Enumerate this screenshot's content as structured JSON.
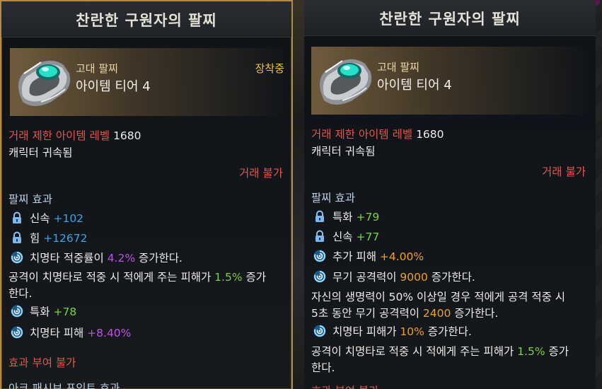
{
  "left": {
    "title": "찬란한 구원자의 팔찌",
    "grade": "고대 팔찌",
    "tier": "아이템 티어 4",
    "equipped": "장착중",
    "trade_level_label": "거래 제한 아이템 레벨",
    "trade_level_value": "1680",
    "bound": "캐릭터 귀속됨",
    "tradable": "거래 불가",
    "effect_header": "팔찌 효과",
    "stat1_name": "신속",
    "stat1_value": "+102",
    "stat2_name": "힘",
    "stat2_value": "+12672",
    "e1_pre": "치명타 적중률이 ",
    "e1_val": "4.2%",
    "e1_post": " 증가한다.",
    "e1b_pre": "공격이 치명타로 적중 시 적에게 주는 피해가 ",
    "e1b_val": "1.5%",
    "e1b_post": " 증가",
    "e1b_line2": "한다.",
    "e2_name": "특화",
    "e2_value": "+78",
    "e3_name": "치명타 피해",
    "e3_value": "+8.40%",
    "no_effect": "효과 부여 불가",
    "ark_passive": "아크 패시브 포인트 효과"
  },
  "right": {
    "title": "찬란한 구원자의 팔찌",
    "grade": "고대 팔찌",
    "tier": "아이템 티어 4",
    "trade_level_label": "거래 제한 아이템 레벨",
    "trade_level_value": "1680",
    "bound": "캐릭터 귀속됨",
    "tradable": "거래 불가",
    "effect_header": "팔찌 효과",
    "stat1_name": "특화",
    "stat1_value": "+79",
    "stat2_name": "신속",
    "stat2_value": "+77",
    "e1_name": "추가 피해 ",
    "e1_value": "+4.00%",
    "e2_pre": "무기 공격력이 ",
    "e2_val": "9000",
    "e2_post": " 증가한다.",
    "e2b_line1": "자신의 생명력이 50% 이상일 경우 적에게 공격 적중 시",
    "e2b_pre": "5초 동안 무기 공격력이 ",
    "e2b_val": "2400",
    "e2b_post": " 증가한다.",
    "e3_pre": "치명타 피해가 ",
    "e3_val": "10%",
    "e3_post": " 증가한다.",
    "e3b_pre": "공격이 치명타로 적중 시 적에게 주는 피해가 ",
    "e3b_val": "1.5%",
    "e3b_post": " 증가",
    "e3b_line2": "한다.",
    "no_effect_partial": "효과 부여 불가"
  },
  "colors": {
    "frame_gold": "#b88a3e",
    "red": "#e0584c",
    "blue": "#3aa6e8",
    "green": "#7cd23a",
    "purple": "#c050e8",
    "orange": "#f0a020",
    "equipped": "#f0c23a"
  },
  "icons": [
    "bracelet-icon",
    "lock-icon",
    "swirl-icon"
  ]
}
